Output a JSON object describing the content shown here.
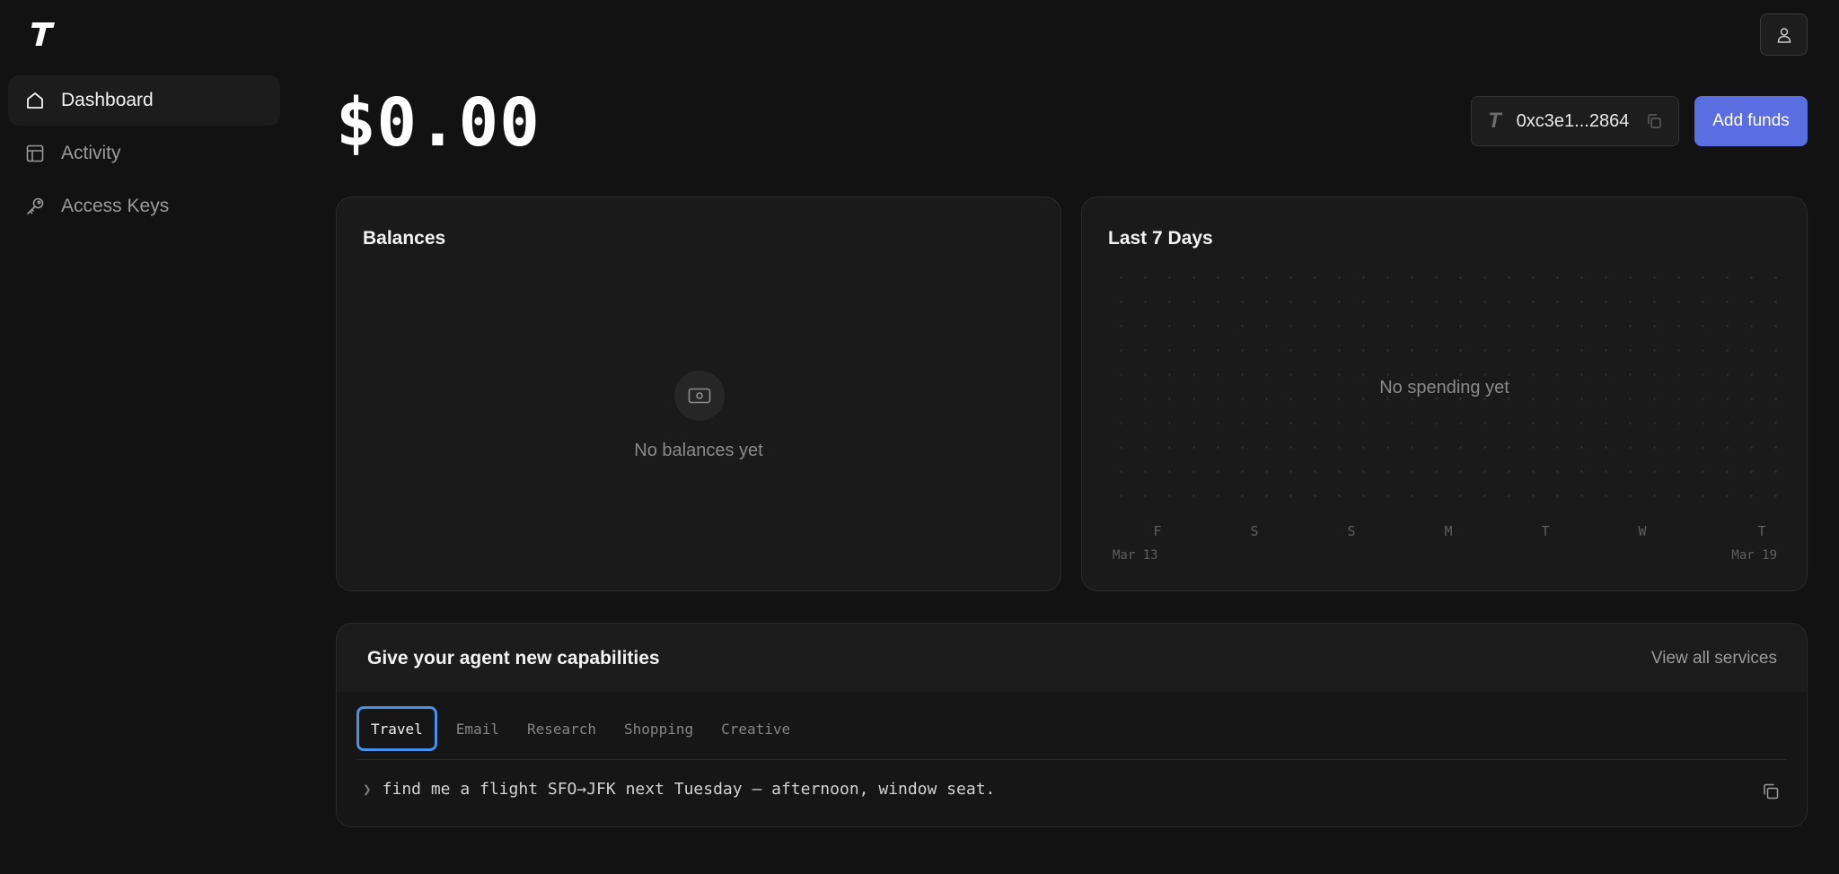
{
  "sidebar": {
    "logo": "T",
    "items": [
      {
        "label": "Dashboard",
        "icon": "home-icon",
        "active": true
      },
      {
        "label": "Activity",
        "icon": "table-icon",
        "active": false
      },
      {
        "label": "Access Keys",
        "icon": "key-icon",
        "active": false
      }
    ]
  },
  "header": {
    "balance": "$0.00",
    "wallet_mark": "T",
    "wallet_address": "0xc3e1...2864",
    "add_funds_label": "Add funds"
  },
  "balances": {
    "title": "Balances",
    "empty_text": "No balances yet"
  },
  "last7": {
    "title": "Last 7 Days",
    "empty_text": "No spending yet",
    "days": [
      "F",
      "S",
      "S",
      "M",
      "T",
      "W",
      "T"
    ],
    "start_date": "Mar 13",
    "end_date": "Mar 19"
  },
  "capabilities": {
    "title": "Give your agent new capabilities",
    "view_all_label": "View all services",
    "tabs": [
      "Travel",
      "Email",
      "Research",
      "Shopping",
      "Creative"
    ],
    "active_tab": "Travel",
    "prompt_caret": "❯",
    "prompt": "find me a flight SFO→JFK next Tuesday — afternoon, window seat."
  },
  "colors": {
    "background": "#121212",
    "accent": "#5b6ee1",
    "focus_ring": "#4a8fe8"
  }
}
